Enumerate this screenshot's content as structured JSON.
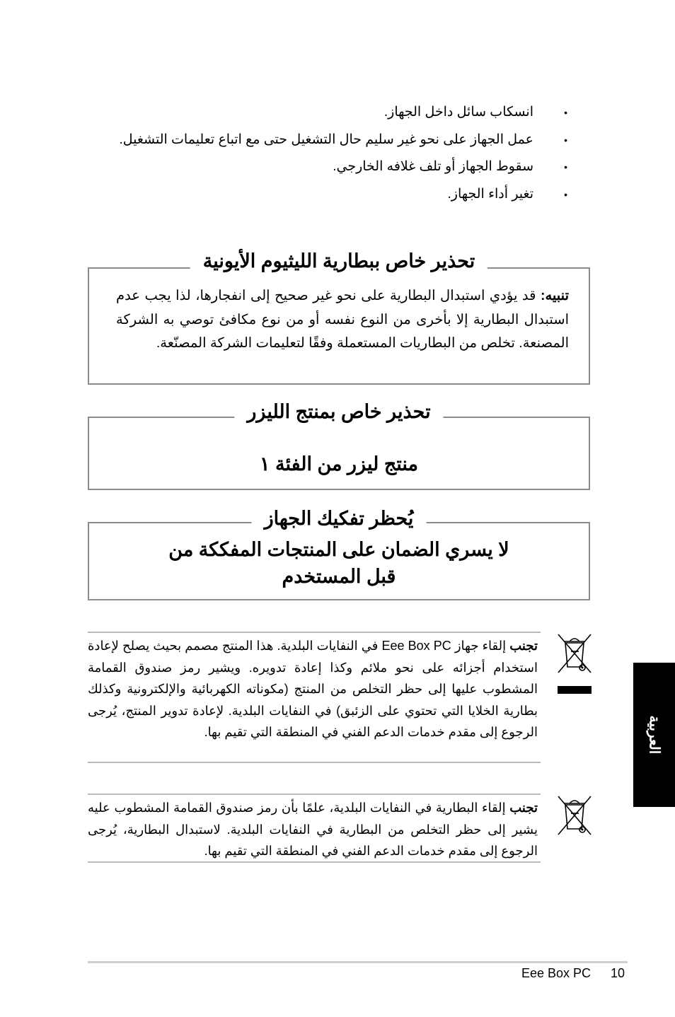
{
  "bullets": [
    "انسكاب سائل داخل الجهاز.",
    "عمل الجهاز على نحو غير سليم حال التشغيل حتى مع اتباع تعليمات التشغيل.",
    "سقوط الجهاز أو تلف غلافه الخارجي.",
    "تغير أداء الجهاز."
  ],
  "bullet_glyph": "•",
  "lithium_warning": {
    "title": "تحذير خاص ببطارية الليثيوم الأيونية",
    "label": "تنبيه:",
    "body": " قد يؤدي استبدال البطارية على نحو غير صحيح إلى انفجارها، لذا يجب عدم استبدال البطارية إلا بأخرى من النوع نفسه أو من نوع مكافئ توصي به الشركة المصنعة. تخلص من البطاريات المستعملة وفقًا لتعليمات الشركة المصنّعة."
  },
  "laser_warning": {
    "title": "تحذير خاص بمنتج الليزر",
    "body": "منتج ليزر من الفئة ١"
  },
  "disassembly_warning": {
    "title": "يُحظر تفكيك الجهاز",
    "line1": "لا يسري الضمان على المنتجات المفككة من",
    "line2": "قبل المستخدم"
  },
  "recycle_product": {
    "label": "تجنب",
    "body": " إلقاء جهاز Eee Box PC في النفايات البلدية. هذا المنتج مصمم بحيث يصلح لإعادة استخدام أجزائه على نحو ملائم وكذا إعادة تدويره. ويشير رمز صندوق القمامة المشطوب عليها إلى حظر التخلص من المنتج (مكوناته الكهربائية والإلكترونية وكذلك بطارية الخلايا التي تحتوي على الزئبق) في النفايات البلدية. لإعادة تدوير المنتج، يُرجى الرجوع إلى مقدم خدمات الدعم الفني في المنطقة التي تقيم بها.",
    "icon": "crossed-out-wheelie-bin-icon"
  },
  "recycle_battery": {
    "label": "تجنب",
    "body": " إلقاء البطارية في النفايات البلدية، علمًا بأن رمز صندوق القمامة المشطوب عليه يشير إلى حظر التخلص من البطارية في النفايات البلدية. لاستبدال البطارية، يُرجى الرجوع إلى مقدم خدمات الدعم الفني في المنطقة التي تقيم بها.",
    "icon": "crossed-out-wheelie-bin-icon"
  },
  "side_tab": "العربية",
  "footer": {
    "product": "Eee Box PC",
    "page": "10"
  }
}
